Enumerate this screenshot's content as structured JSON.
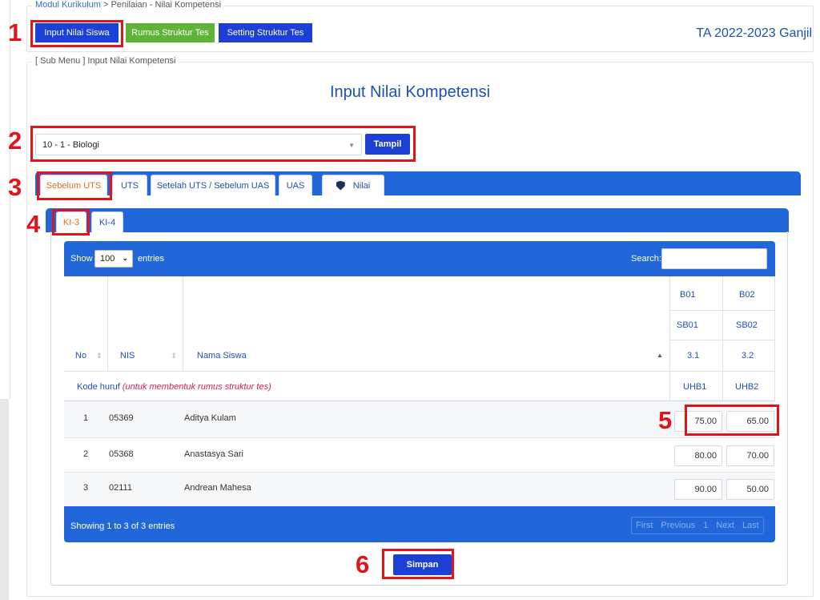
{
  "breadcrumb": {
    "module": "Modul Kurikulum",
    "separator": " > ",
    "current": "Penilaian - Nilai Kompetensi"
  },
  "toolbar": {
    "input_nilai": "Input Nilai Siswa",
    "rumus": "Rumus Struktur Tes",
    "setting": "Setting Struktur Tes"
  },
  "academic_year": "TA 2022-2023 Ganjil",
  "submenu_legend": "[ Sub Menu ] Input Nilai Kompetensi",
  "page_title": "Input Nilai Kompetensi",
  "class_select": {
    "value": "10 - 1 - Biologi",
    "button": "Tampil"
  },
  "tabs": [
    "Sebelum UTS",
    "UTS",
    "Setelah UTS / Sebelum UAS",
    "UAS",
    "Nilai"
  ],
  "subtabs": [
    "KI-3",
    "KI-4"
  ],
  "table": {
    "show": "Show",
    "entries_value": "100",
    "entries": "entries",
    "search": "Search:",
    "headers": {
      "no": "No",
      "nis": "NIS",
      "nama": "Nama Siswa"
    },
    "col_codes": [
      {
        "b": "B01",
        "sb": "SB01",
        "kd": "3.1",
        "uh": "UHB1"
      },
      {
        "b": "B02",
        "sb": "SB02",
        "kd": "3.2",
        "uh": "UHB2"
      }
    ],
    "kode_label": "Kode huruf",
    "kode_note": "(untuk membentuk rumus struktur tes)",
    "rows": [
      {
        "no": "1",
        "nis": "05369",
        "nama": "Aditya Kulam",
        "v1": "75.00",
        "v2": "65.00"
      },
      {
        "no": "2",
        "nis": "05368",
        "nama": "Anastasya Sari",
        "v1": "80.00",
        "v2": "70.00"
      },
      {
        "no": "3",
        "nis": "02111",
        "nama": "Andrean Mahesa",
        "v1": "90.00",
        "v2": "50.00"
      }
    ],
    "info": "Showing 1 to 3 of 3 entries",
    "pager": [
      "First",
      "Previous",
      "1",
      "Next",
      "Last"
    ]
  },
  "save_button": "Simpan",
  "markers": [
    "1",
    "2",
    "3",
    "4",
    "5",
    "6"
  ],
  "colors": {
    "primary": "#2167d9",
    "button_blue": "#1c3fd6",
    "button_green": "#5fb336",
    "annotation_red": "#e1141c",
    "active_tab": "#e2701a"
  }
}
